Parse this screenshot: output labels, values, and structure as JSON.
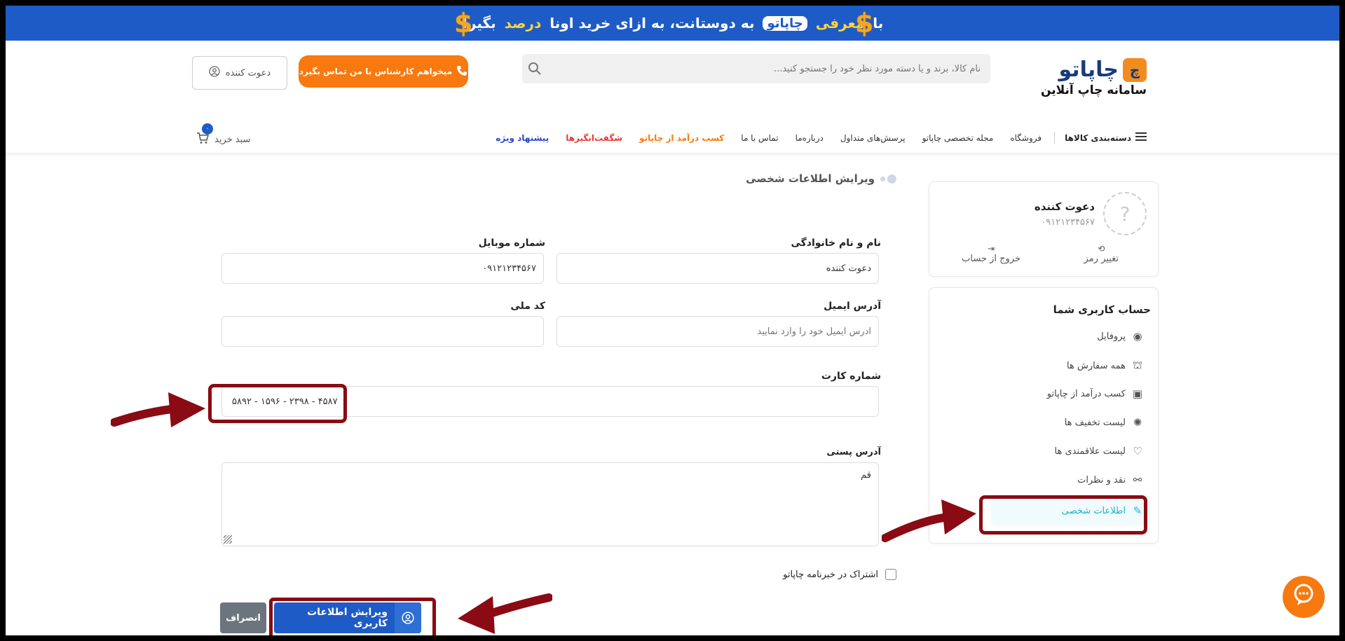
{
  "banner": {
    "part1": "با",
    "highlight1": "معرفی",
    "brand": "چاپاتو",
    "part2": "به دوستانت، به ازای خرید اونا",
    "highlight2": "درصد",
    "part3": "بگیر!"
  },
  "header": {
    "logo_name": "چاپاتو",
    "logo_sub": "سامانه چاپ آنلاین",
    "search_placeholder": "نام کالا، برند و یا دسته مورد نظر خود را جستجو کنید...",
    "cta_label": "میخواهم کارشناس با من تماس بگیرد",
    "invite_label": "دعوت کننده"
  },
  "nav": {
    "categories": "دسته‌بندی کالاها",
    "items": [
      "فروشگاه",
      "مجله تخصصی چاپاتو",
      "پرسش‌های متداول",
      "درباره‌ما",
      "تماس با ما"
    ],
    "earn": "کسب درآمد از چاپاتو",
    "amazing": "شگفت‌انگیزها",
    "special": "پیشنهاد ویژه",
    "cart_label": "سبد خرید",
    "cart_count": "۰"
  },
  "user_card": {
    "name": "دعوت کننده",
    "phone": "۰۹۱۲۱۲۳۴۵۶۷",
    "change_password": "تغییر رمز",
    "logout": "خروج از حساب"
  },
  "account_menu": {
    "title": "حساب کاربری شما",
    "items": [
      {
        "label": "پروفایل",
        "icon": "user-circle-icon"
      },
      {
        "label": "همه سفارش ها",
        "icon": "basket-icon"
      },
      {
        "label": "کسب درآمد از چاپاتو",
        "icon": "money-icon"
      },
      {
        "label": "لیست تخفیف ها",
        "icon": "discount-icon"
      },
      {
        "label": "لیست علاقمندی ها",
        "icon": "heart-icon"
      },
      {
        "label": "نقد و نظرات",
        "icon": "glasses-icon"
      },
      {
        "label": "اطلاعات شخصی",
        "icon": "user-edit-icon",
        "active": true
      }
    ]
  },
  "form": {
    "section_title": "ویرایش اطلاعات شخصی",
    "full_name_label": "نام و نام خانوادگی",
    "full_name_value": "دعوت کننده",
    "mobile_label": "شماره موبایل",
    "mobile_value": "۰۹۱۲۱۲۳۴۵۶۷",
    "email_label": "آدرس ایمیل",
    "email_placeholder": "آدرس ایمیل خود را وارد نمایید",
    "national_code_label": "کد ملی",
    "national_code_value": "",
    "card_number_label": "شماره کارت",
    "card_number_value": "۵۸۹۲ - ۱۵۹۶ - ۲۳۹۸ - ۴۵۸۷",
    "postal_address_label": "آدرس پستی",
    "postal_address_value": "قم",
    "newsletter_label": "اشتراک در خبرنامه چاپاتو",
    "newsletter_checked": false,
    "submit_label": "ویرایش اطلاعات کاربری",
    "cancel_label": "انصراف"
  },
  "colors": {
    "brand_blue": "#1e5bc6",
    "brand_orange": "#f7790f",
    "annotation_red": "#8a0b13",
    "active_cyan": "#18b3c9"
  }
}
